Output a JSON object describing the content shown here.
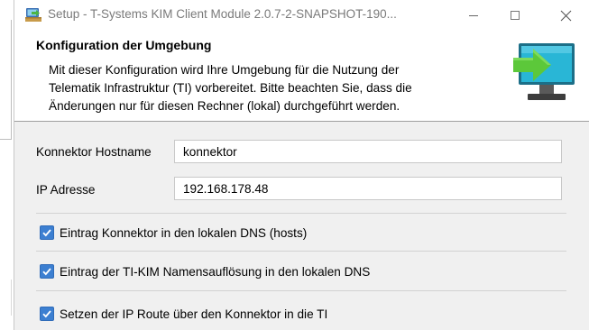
{
  "window": {
    "title": "Setup - T-Systems KIM Client Module 2.0.7-2-SNAPSHOT-190...",
    "app_icon": "setup-installer-icon",
    "controls": {
      "minimize_icon": "minimize-icon",
      "maximize_icon": "maximize-icon",
      "close_icon": "close-icon"
    }
  },
  "header": {
    "title": "Konfiguration der Umgebung",
    "description_lines": [
      "Mit dieser Konfiguration wird Ihre Umgebung für die Nutzung der",
      "Telematik Infrastruktur (TI) vorbereitet. Bitte beachten Sie, dass die",
      "Änderungen nur für diesen Rechner (lokal) durchgeführt werden."
    ],
    "icon": "computer-monitor-arrow-icon"
  },
  "form": {
    "connector_hostname": {
      "label": "Konnektor Hostname",
      "value": "konnektor"
    },
    "ip_address": {
      "label": "IP Adresse",
      "value": "192.168.178.48"
    }
  },
  "options": [
    {
      "label": "Eintrag Konnektor in den lokalen DNS (hosts)",
      "checked": true
    },
    {
      "label": "Eintrag der TI-KIM Namensauflösung in den lokalen DNS",
      "checked": true
    },
    {
      "label": "Setzen der IP Route über den Konnektor in die TI",
      "checked": true
    }
  ],
  "colors": {
    "accent": "#3c7fd1",
    "content_background": "#f0f0f0",
    "header_icon_screen": "#29b6d6",
    "header_icon_arrow": "#5cc83a"
  }
}
